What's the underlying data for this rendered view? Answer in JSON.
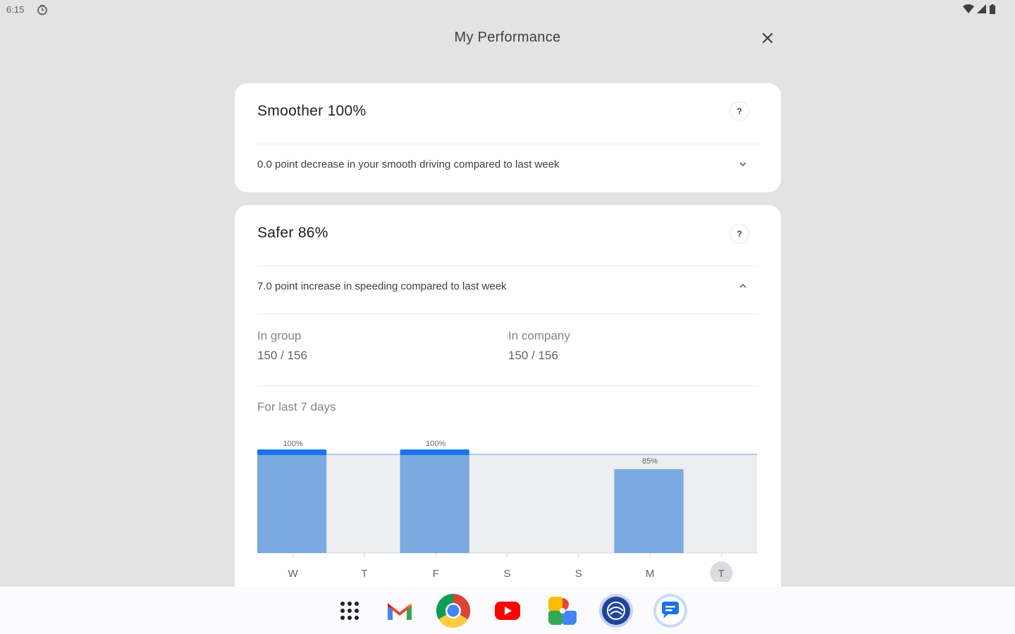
{
  "status_bar": {
    "time": "6:15"
  },
  "header": {
    "title": "My Performance"
  },
  "smoother": {
    "title": "Smoother 100%",
    "help": "?",
    "summary": "0.0 point decrease in your smooth driving compared to last week"
  },
  "safer": {
    "title": "Safer 86%",
    "help": "?",
    "summary": "7.0 point increase in speeding compared to last week",
    "in_group": {
      "label": "In group",
      "value": "150 / 156"
    },
    "in_company": {
      "label": "In company",
      "value": "150 / 156"
    },
    "range_label": "For last 7 days"
  },
  "chart_data": {
    "type": "bar",
    "categories": [
      "W",
      "T",
      "F",
      "S",
      "S",
      "M",
      "T"
    ],
    "values": [
      100,
      null,
      100,
      null,
      null,
      85,
      null
    ],
    "data_labels": [
      "100%",
      "",
      "100%",
      "",
      "",
      "85%",
      ""
    ],
    "highlighted_category_index": 6,
    "reference_line": 100,
    "ylim": [
      0,
      100
    ],
    "bar_color": "#7aaadf",
    "cap_color": "#1a73e8",
    "band_color": "#eceef1"
  },
  "dock": {
    "icons": [
      "app-drawer-icon",
      "gmail-icon",
      "chrome-icon",
      "youtube-icon",
      "photos-icon",
      "fleet-app-icon",
      "messages-icon"
    ]
  }
}
